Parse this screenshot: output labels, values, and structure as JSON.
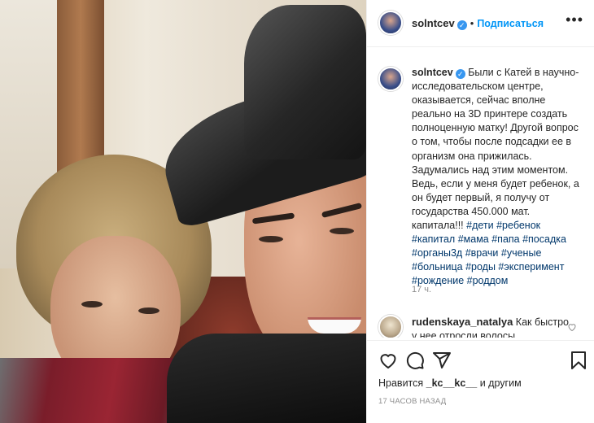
{
  "post": {
    "photo_alt": "",
    "header": {
      "username": "solntcev",
      "verified_mark": "✓",
      "separator": "•",
      "follow_label": "Подписаться",
      "more_label": "•••"
    },
    "caption": {
      "username": "solntcev",
      "text": "Были с Катей в научно-исследовательском центре, оказывается, сейчас вполне реально на 3D принтере создать полноценную матку! Другой вопрос о том, чтобы после подсадки ее в организм она прижилась. Задумались над этим моментом. Ведь, если у меня будет ребенок, а он будет первый, я получу от государства 450.000 мат. капитала!!!",
      "hashtags": "#дети #ребенок #капитал #мама #папа #посадка #органы3д #врачи #ученые #больница #роды #эксперимент #рождение #роддом",
      "time": "17 ч."
    },
    "comment": {
      "username": "rudenskaya_natalya",
      "text": "Как быстро у нее отросли волосы"
    },
    "actions": {
      "like_icon": "heart-outline",
      "comment_icon": "speech-bubble",
      "share_icon": "paper-plane",
      "save_icon": "bookmark"
    },
    "likes": {
      "prefix": "Нравится",
      "user": "_kc__kc__",
      "suffix": "и другим"
    },
    "timestamp": "17 ЧАСОВ НАЗАД"
  },
  "colors": {
    "link": "#0095f6",
    "hashtag": "#00376b",
    "muted": "#8e8e8e",
    "verified": "#3897f0"
  }
}
